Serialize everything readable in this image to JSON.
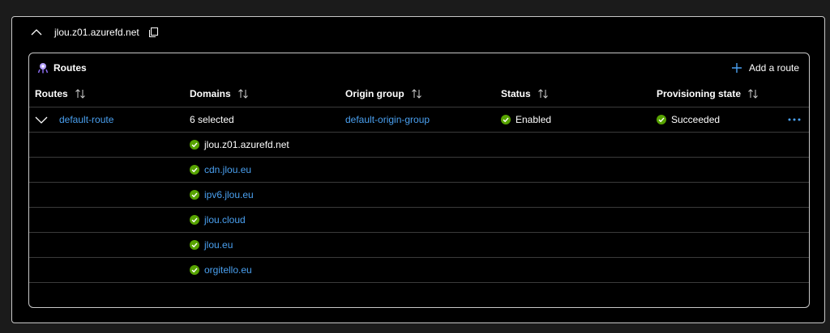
{
  "endpoint": {
    "name": "jlou.z01.azurefd.net"
  },
  "routes_card": {
    "title": "Routes",
    "add_label": "Add a route",
    "columns": [
      "Routes",
      "Domains",
      "Origin group",
      "Status",
      "Provisioning state"
    ],
    "route": {
      "name": "default-route",
      "domains_summary": "6 selected",
      "origin_group": "default-origin-group",
      "status": "Enabled",
      "provisioning_state": "Succeeded"
    },
    "domains": [
      "jlou.z01.azurefd.net",
      "cdn.jlou.eu",
      "ipv6.jlou.eu",
      "jlou.cloud",
      "jlou.eu",
      "orgitello.eu"
    ]
  },
  "colors": {
    "link": "#4aa0f0",
    "success": "#57a300",
    "background": "#000000",
    "border": "#c8c8c8"
  },
  "icons": [
    "chevron-up-icon",
    "copy-icon",
    "routes-icon",
    "plus-icon",
    "sort-icon",
    "chevron-down-icon",
    "success-icon",
    "more-icon"
  ]
}
